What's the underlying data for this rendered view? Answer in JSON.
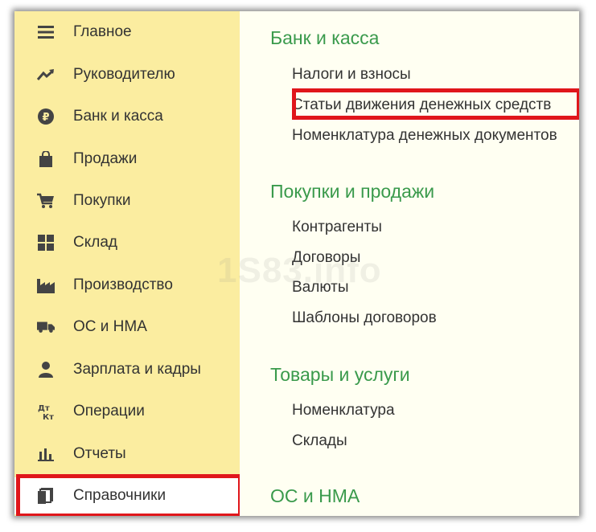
{
  "sidebar": {
    "items": [
      {
        "label": "Главное",
        "icon": "menu-lines-icon"
      },
      {
        "label": "Руководителю",
        "icon": "trend-up-icon"
      },
      {
        "label": "Банк и касса",
        "icon": "ruble-coin-icon"
      },
      {
        "label": "Продажи",
        "icon": "shopping-bag-icon"
      },
      {
        "label": "Покупки",
        "icon": "shopping-cart-icon"
      },
      {
        "label": "Склад",
        "icon": "warehouse-grid-icon"
      },
      {
        "label": "Производство",
        "icon": "factory-icon"
      },
      {
        "label": "ОС и НМА",
        "icon": "truck-icon"
      },
      {
        "label": "Зарплата и кадры",
        "icon": "person-icon"
      },
      {
        "label": "Операции",
        "icon": "debit-credit-icon"
      },
      {
        "label": "Отчеты",
        "icon": "bar-chart-icon"
      },
      {
        "label": "Справочники",
        "icon": "books-icon"
      }
    ],
    "active_index": 11
  },
  "content": {
    "sections": [
      {
        "title": "Банк и касса",
        "links": [
          "Налоги и взносы",
          "Статьи движения денежных средств",
          "Номенклатура денежных документов"
        ]
      },
      {
        "title": "Покупки и продажи",
        "links": [
          "Контрагенты",
          "Договоры",
          "Валюты",
          "Шаблоны договоров"
        ]
      },
      {
        "title": "Товары и услуги",
        "links": [
          "Номенклатура",
          "Склады"
        ]
      },
      {
        "title": "ОС и НМА",
        "links": []
      }
    ]
  },
  "watermark": "1S83.info",
  "colors": {
    "sidebar_bg": "#fbeda0",
    "content_bg": "#fffff2",
    "section_title": "#3a9a4c",
    "highlight_box": "#e0161b",
    "text": "#333333"
  }
}
